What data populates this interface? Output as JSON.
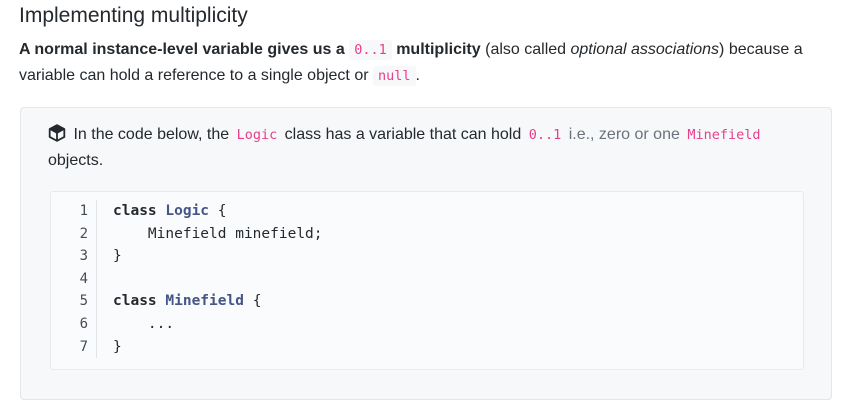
{
  "heading": "Implementing multiplicity",
  "intro": {
    "bold_start": "A normal instance-level variable gives us a",
    "code_mult": "0..1",
    "bold_mult": "multiplicity",
    "text_also": "(also called",
    "italic_term": "optional associations",
    "text_close": ")",
    "text_because": "because a variable can hold a reference to a single object or",
    "code_null": "null",
    "text_period": "."
  },
  "info_box": {
    "icon": "cube-icon",
    "text_before": "In the code below, the",
    "code_class": "Logic",
    "text_middle": "class has a variable that can hold",
    "code_mult": "0..1",
    "text_ie": "i.e., zero or one",
    "code_minefield": "Minefield",
    "text_end": "objects."
  },
  "code": {
    "lines": [
      {
        "num": "1",
        "kw": "class",
        "cls": "Logic",
        "rest": " {"
      },
      {
        "num": "2",
        "text": "    Minefield minefield;"
      },
      {
        "num": "3",
        "text": "}"
      },
      {
        "num": "4",
        "text": ""
      },
      {
        "num": "5",
        "kw": "class",
        "cls": "Minefield",
        "rest": " {"
      },
      {
        "num": "6",
        "text": "    ..."
      },
      {
        "num": "7",
        "text": "}"
      }
    ]
  },
  "colors": {
    "inline_code": "#e83e8c",
    "class_name": "#445588",
    "box_bg": "#f6f8fa"
  }
}
